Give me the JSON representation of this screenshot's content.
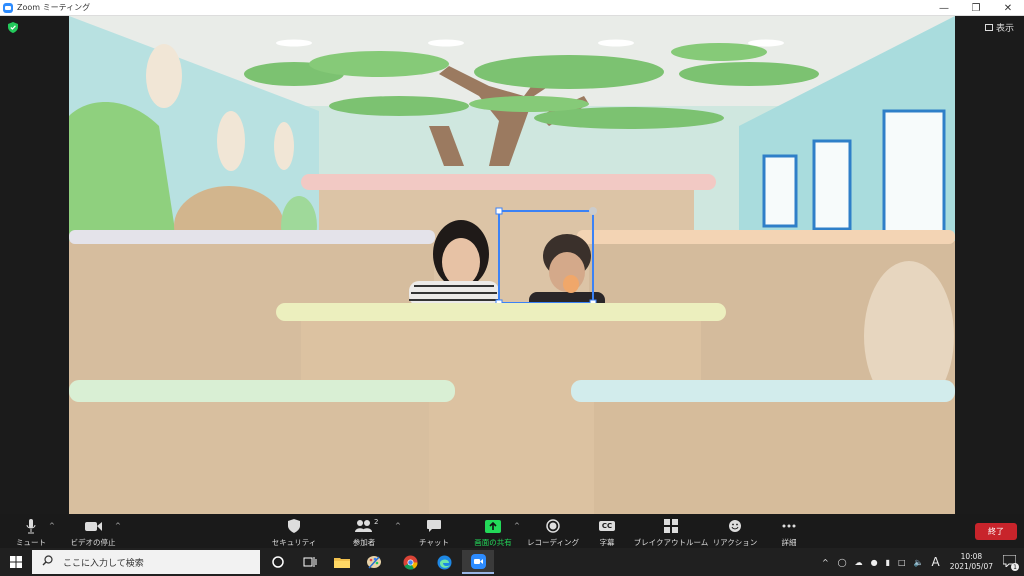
{
  "window": {
    "title": "Zoom ミーティング",
    "controls": [
      "—",
      "❐",
      "✕"
    ]
  },
  "meeting": {
    "view_label": "表示"
  },
  "toolbar": {
    "mute_label": "ミュート",
    "video_label": "ビデオの停止",
    "security_label": "セキュリティ",
    "participants_label": "参加者",
    "participants_count": "2",
    "chat_label": "チャット",
    "share_label": "画面の共有",
    "record_label": "レコーディング",
    "cc_label": "字幕",
    "cc_icon_text": "CC",
    "breakout_label": "ブレイクアウトルーム",
    "reaction_label": "リアクション",
    "more_label": "詳細",
    "end_label": "終了",
    "share_color": "#23d959",
    "end_color": "#c8242b"
  },
  "taskbar": {
    "search_placeholder": "ここに入力して検索",
    "time": "10:08",
    "date": "2021/05/07",
    "ime": "A",
    "notification_count": "1"
  }
}
